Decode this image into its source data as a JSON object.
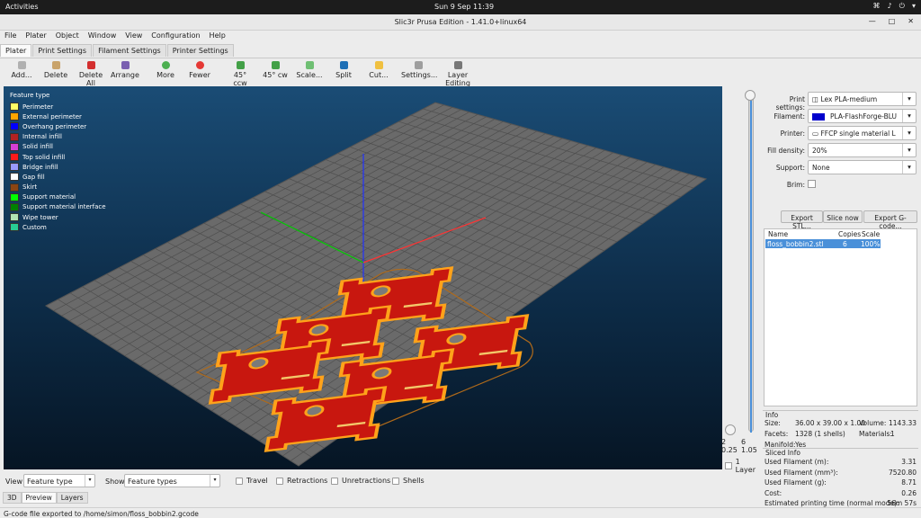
{
  "topbar": {
    "activities": "Activities",
    "clock": "Sun 9 Sep  11:39"
  },
  "window": {
    "title": "Slic3r Prusa Edition - 1.41.0+linux64"
  },
  "menu": [
    "File",
    "Plater",
    "Object",
    "Window",
    "View",
    "Configuration",
    "Help"
  ],
  "tabs": [
    "Plater",
    "Print Settings",
    "Filament Settings",
    "Printer Settings"
  ],
  "toolbar": [
    {
      "label": "Add...",
      "icon": "add-icon"
    },
    {
      "label": "Delete",
      "icon": "delete-icon"
    },
    {
      "label": "Delete All",
      "icon": "delete-all-icon"
    },
    {
      "label": "Arrange",
      "icon": "arrange-icon"
    },
    {
      "label": "More",
      "icon": "more-icon"
    },
    {
      "label": "Fewer",
      "icon": "fewer-icon"
    },
    {
      "label": "45° ccw",
      "icon": "rotate-ccw-icon"
    },
    {
      "label": "45° cw",
      "icon": "rotate-cw-icon"
    },
    {
      "label": "Scale...",
      "icon": "scale-icon"
    },
    {
      "label": "Split",
      "icon": "split-icon"
    },
    {
      "label": "Cut...",
      "icon": "cut-icon"
    },
    {
      "label": "Settings...",
      "icon": "settings-icon"
    },
    {
      "label": "Layer Editing",
      "icon": "layer-editing-icon"
    }
  ],
  "legend": {
    "title": "Feature type",
    "items": [
      {
        "label": "Perimeter",
        "color": "#ffff66"
      },
      {
        "label": "External perimeter",
        "color": "#ffa500"
      },
      {
        "label": "Overhang perimeter",
        "color": "#0000ff"
      },
      {
        "label": "Internal infill",
        "color": "#b22222"
      },
      {
        "label": "Solid infill",
        "color": "#d63fd6"
      },
      {
        "label": "Top solid infill",
        "color": "#ff1a1a"
      },
      {
        "label": "Bridge infill",
        "color": "#9999ff"
      },
      {
        "label": "Gap fill",
        "color": "#ffffff"
      },
      {
        "label": "Skirt",
        "color": "#8b4513"
      },
      {
        "label": "Support material",
        "color": "#00ff00"
      },
      {
        "label": "Support material interface",
        "color": "#008000"
      },
      {
        "label": "Wipe tower",
        "color": "#b3e3b3"
      },
      {
        "label": "Custom",
        "color": "#28cc94"
      }
    ]
  },
  "slider": {
    "top_value": "",
    "bottom_left": "2",
    "bottom_right": "6",
    "bottom_left2": "0.25",
    "bottom_right2": "1.05",
    "one_layer_label": "1 Layer"
  },
  "settings": {
    "print_label": "Print settings:",
    "print_value": "Lex PLA-medium",
    "filament_label": "Filament:",
    "filament_value": "PLA-FlashForge-BLU",
    "filament_color": "#0000cc",
    "printer_label": "Printer:",
    "printer_value": "FFCP single material L",
    "fill_label": "Fill density:",
    "fill_value": "20%",
    "support_label": "Support:",
    "support_value": "None",
    "brim_label": "Brim:"
  },
  "actions": {
    "export_stl": "Export STL...",
    "slice_now": "Slice now",
    "export_gcode": "Export G-code..."
  },
  "objects": {
    "headers": {
      "name": "Name",
      "copies": "Copies",
      "scale": "Scale"
    },
    "rows": [
      {
        "name": "floss_bobbin2.stl",
        "copies": "6",
        "scale": "100%"
      }
    ]
  },
  "info": {
    "title": "Info",
    "size_label": "Size:",
    "size_value": "36.00 x 39.00 x 1.00",
    "volume_label": "Volume:",
    "volume_value": "1143.33",
    "facets_label": "Facets:",
    "facets_value": "1328 (1 shells)",
    "materials_label": "Materials:",
    "materials_value": "1",
    "manifold_label": "Manifold:",
    "manifold_value": "Yes"
  },
  "sliced_info": {
    "title": "Sliced Info",
    "rows": [
      {
        "label": "Used Filament (m):",
        "value": "3.31"
      },
      {
        "label": "Used Filament (mm³):",
        "value": "7520.80"
      },
      {
        "label": "Used Filament (g):",
        "value": "8.71"
      },
      {
        "label": "Cost:",
        "value": "0.26"
      },
      {
        "label": "Estimated printing time (normal mode):",
        "value": "56m 57s"
      }
    ]
  },
  "bottom": {
    "view_label": "View",
    "view_value": "Feature type",
    "show_label": "Show",
    "show_value": "Feature types",
    "checks": [
      "Travel",
      "Retractions",
      "Unretractions",
      "Shells"
    ]
  },
  "view_tabs": [
    "3D",
    "Preview",
    "Layers"
  ],
  "status": "G-code file exported to /home/simon/floss_bobbin2.gcode"
}
